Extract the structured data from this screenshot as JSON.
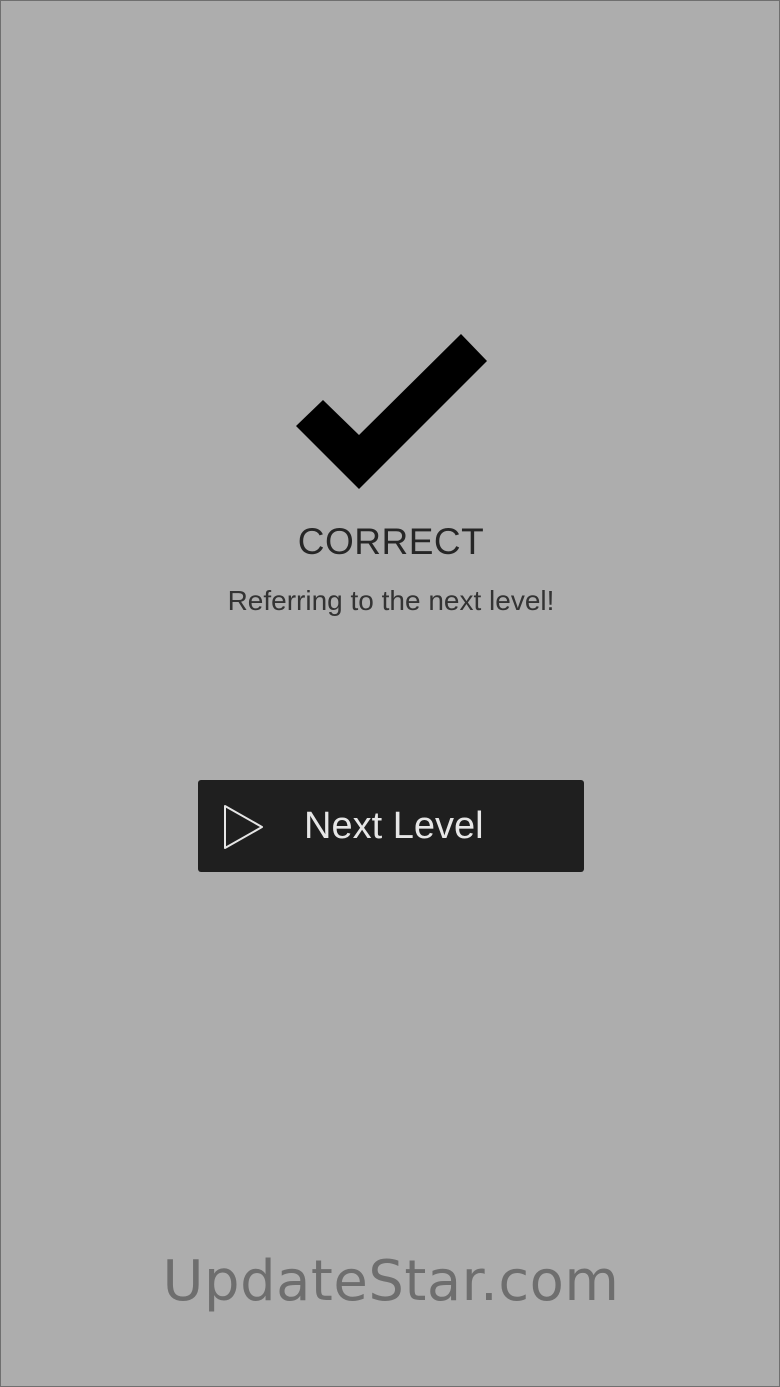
{
  "result": {
    "title": "CORRECT",
    "subtitle": "Referring to the next level!"
  },
  "next_button": {
    "label": "Next Level",
    "icon": "play-icon"
  },
  "watermark": {
    "text": "UpdateStar.com"
  },
  "colors": {
    "background": "#adadad",
    "button_bg": "#1f1f1f",
    "button_text": "#e6e6e6",
    "check": "#000000"
  }
}
